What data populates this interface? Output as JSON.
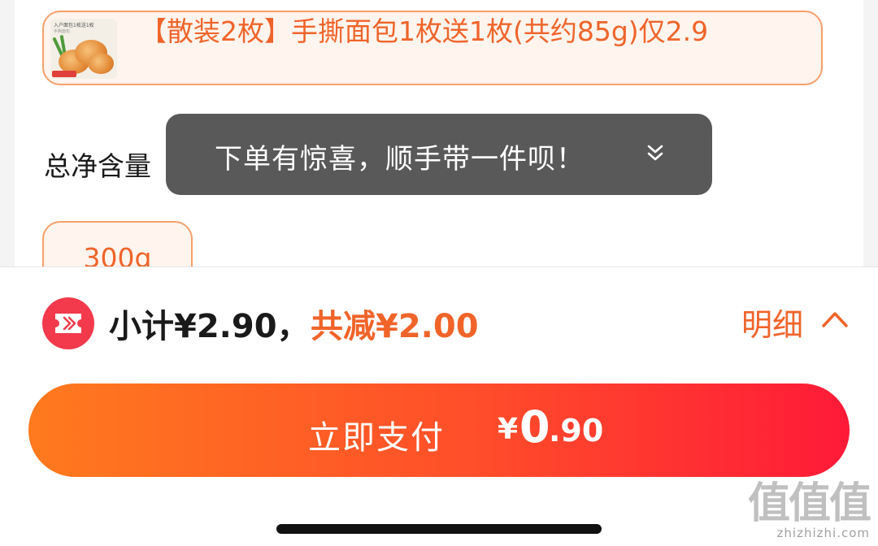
{
  "product_option": {
    "thumbnail_caption": "入户面包1枚送1枚",
    "thumbnail_subcaption": "手撕面包",
    "title": "【散装2枚】手撕面包1枚送1枚(共约85g)仅2.9"
  },
  "net_content_section": {
    "label": "总净含量",
    "options": [
      {
        "label": "300g"
      }
    ]
  },
  "toast": {
    "message": "下单有惊喜，顺手带一件呗！",
    "icon": "double-chevron-down-icon"
  },
  "summary": {
    "coupon_icon": "coupon-ticket-icon",
    "subtotal": "小计¥2.90，",
    "discount": "共减¥2.00",
    "detail_label": "明细",
    "detail_icon": "chevron-up-icon"
  },
  "pay_button": {
    "label": "立即支付",
    "currency": "¥",
    "amount_int": "0",
    "amount_dec": ".90"
  },
  "watermark": {
    "logo": "值值值",
    "url": "zhizhizhi.com"
  },
  "colors": {
    "accent": "#f0642a",
    "gradient_start": "#ff7a1e",
    "gradient_end": "#ff1a38",
    "toast_bg": "#505050",
    "coupon_red": "#f23a4c"
  }
}
